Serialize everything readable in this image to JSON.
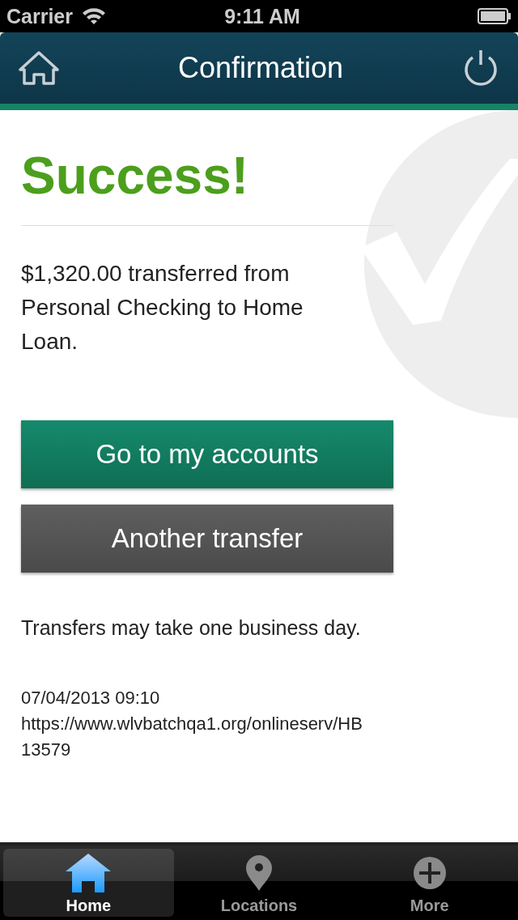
{
  "status_bar": {
    "carrier": "Carrier",
    "time": "9:11 AM"
  },
  "nav_bar": {
    "title": "Confirmation"
  },
  "heading": "Success!",
  "message": "$1,320.00 transferred from Personal Checking to Home Loan.",
  "buttons": [
    {
      "label": "Go to my accounts",
      "kind": "primary"
    },
    {
      "label": "Another transfer",
      "kind": "secondary"
    }
  ],
  "note": "Transfers may take one business day.",
  "meta_lines": [
    "07/04/2013 09:10",
    "https://www.wlvbatchqa1.org/onlineserv/HB",
    "13579"
  ],
  "tab_bar": [
    {
      "label": "Home",
      "kind": "home",
      "selected": true
    },
    {
      "label": "Locations",
      "kind": "pin",
      "selected": false
    },
    {
      "label": "More",
      "kind": "plus",
      "selected": false
    }
  ]
}
